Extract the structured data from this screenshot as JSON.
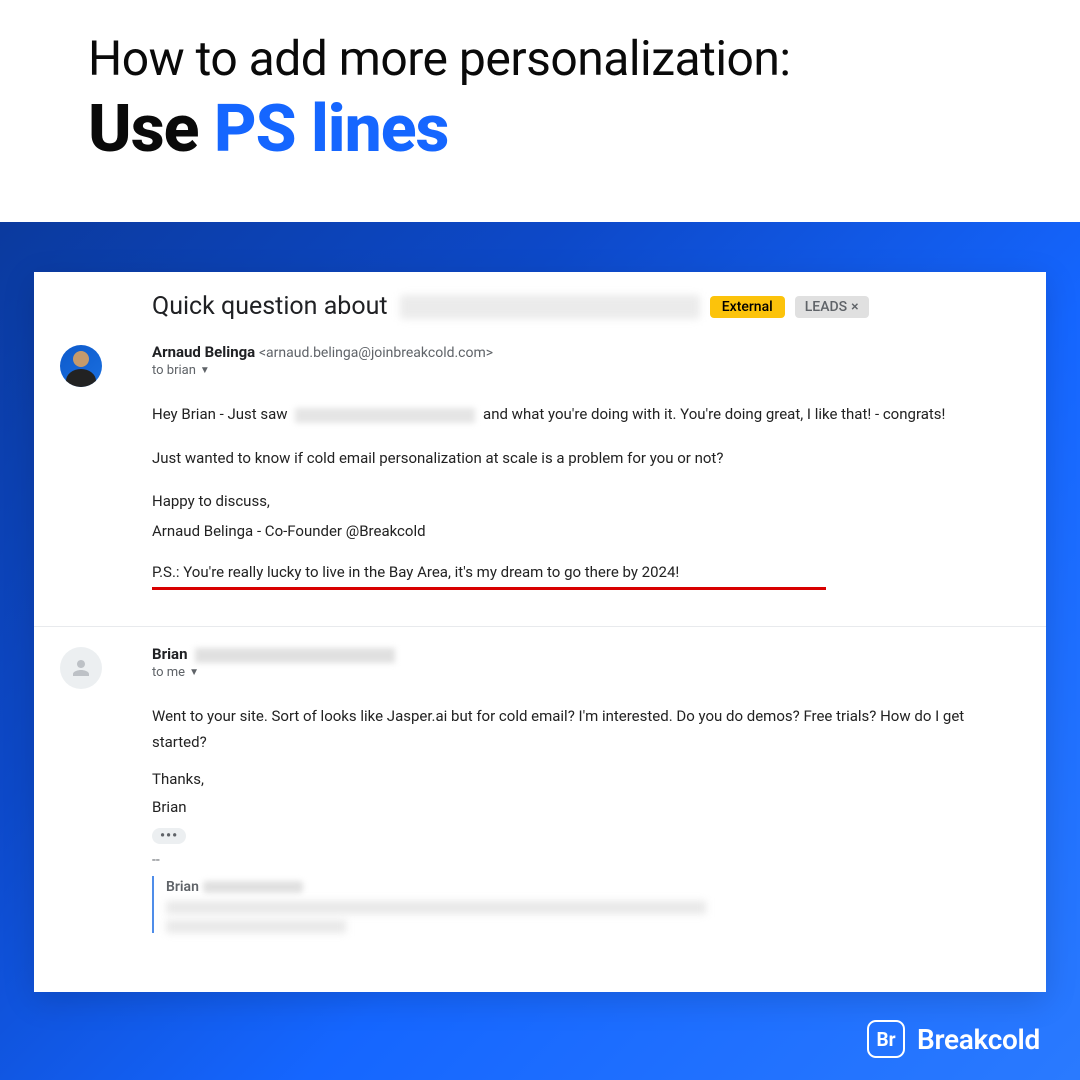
{
  "header": {
    "line1": "How to add more personalization:",
    "line2_a": "Use ",
    "line2_b": "PS lines"
  },
  "email": {
    "subject_prefix": "Quick question about",
    "badges": {
      "external": "External",
      "leads": "LEADS",
      "leads_close": "×"
    }
  },
  "msg1": {
    "sender_name": "Arnaud Belinga",
    "sender_email": "<arnaud.belinga@joinbreakcold.com>",
    "to_prefix": "to brian",
    "p1_a": "Hey Brian - Just saw",
    "p1_b": "and what you're doing with it. You're doing great, I like that! - congrats!",
    "p2": "Just wanted to know if cold email personalization at scale is a problem for you or not?",
    "p3": "Happy to discuss,",
    "p4": "Arnaud Belinga - Co-Founder @Breakcold",
    "ps": "P.S.: You're really lucky to live in the Bay Area, it's my dream to go there by 2024!"
  },
  "msg2": {
    "sender_name": "Brian",
    "to_prefix": "to me",
    "p1": "Went to your site.  Sort of looks like Jasper.ai but for cold email?  I'm interested.  Do you do demos?  Free trials?  How do I get started?",
    "p2": "Thanks,",
    "p3": "Brian",
    "dots": "•••",
    "dashes": "--",
    "quote_name": "Brian"
  },
  "brand": {
    "logo_text": "Br",
    "name": "Breakcold"
  }
}
